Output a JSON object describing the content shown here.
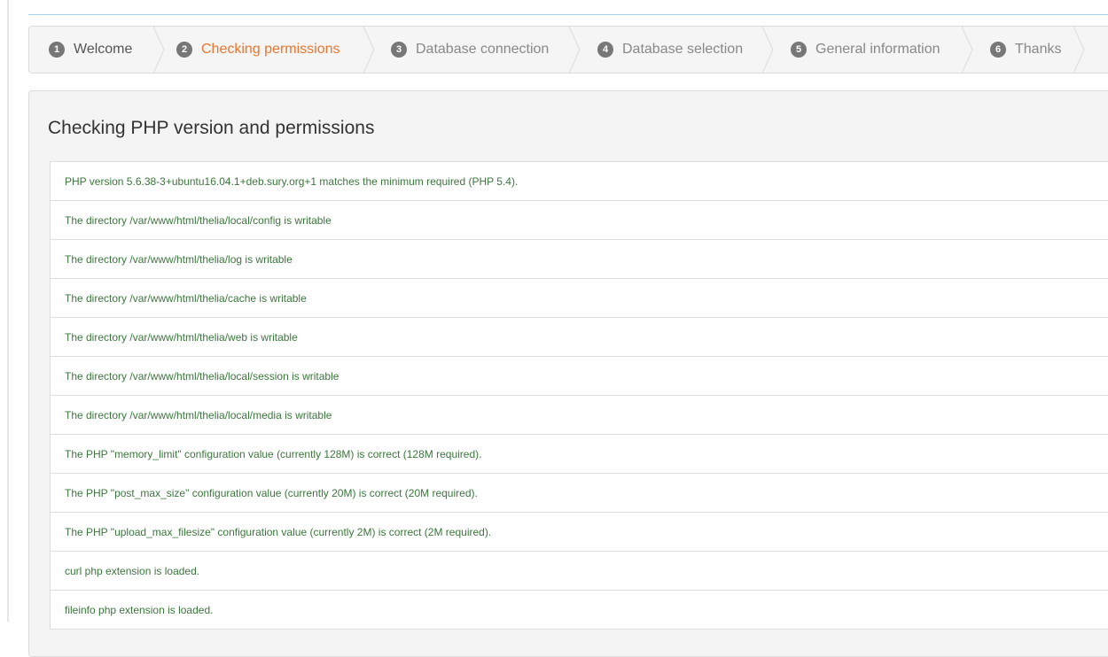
{
  "steps": [
    {
      "num": "1",
      "label": "Welcome",
      "state": "done"
    },
    {
      "num": "2",
      "label": "Checking permissions",
      "state": "active"
    },
    {
      "num": "3",
      "label": "Database connection",
      "state": "pending"
    },
    {
      "num": "4",
      "label": "Database selection",
      "state": "pending"
    },
    {
      "num": "5",
      "label": "General information",
      "state": "pending"
    },
    {
      "num": "6",
      "label": "Thanks",
      "state": "pending"
    }
  ],
  "panel": {
    "title": "Checking PHP version and permissions"
  },
  "checks": [
    "PHP version 5.6.38-3+ubuntu16.04.1+deb.sury.org+1 matches the minimum required (PHP 5.4).",
    "The directory /var/www/html/thelia/local/config is writable",
    "The directory /var/www/html/thelia/log is writable",
    "The directory /var/www/html/thelia/cache is writable",
    "The directory /var/www/html/thelia/web is writable",
    "The directory /var/www/html/thelia/local/session is writable",
    "The directory /var/www/html/thelia/local/media is writable",
    "The PHP \"memory_limit\" configuration value (currently 128M) is correct (128M required).",
    "The PHP \"post_max_size\" configuration value (currently 20M) is correct (20M required).",
    "The PHP \"upload_max_filesize\" configuration value (currently 2M) is correct (2M required).",
    "curl php extension is loaded.",
    "fileinfo php extension is loaded."
  ],
  "colors": {
    "active_step": "#e8772e",
    "success_text": "#3c763d"
  }
}
